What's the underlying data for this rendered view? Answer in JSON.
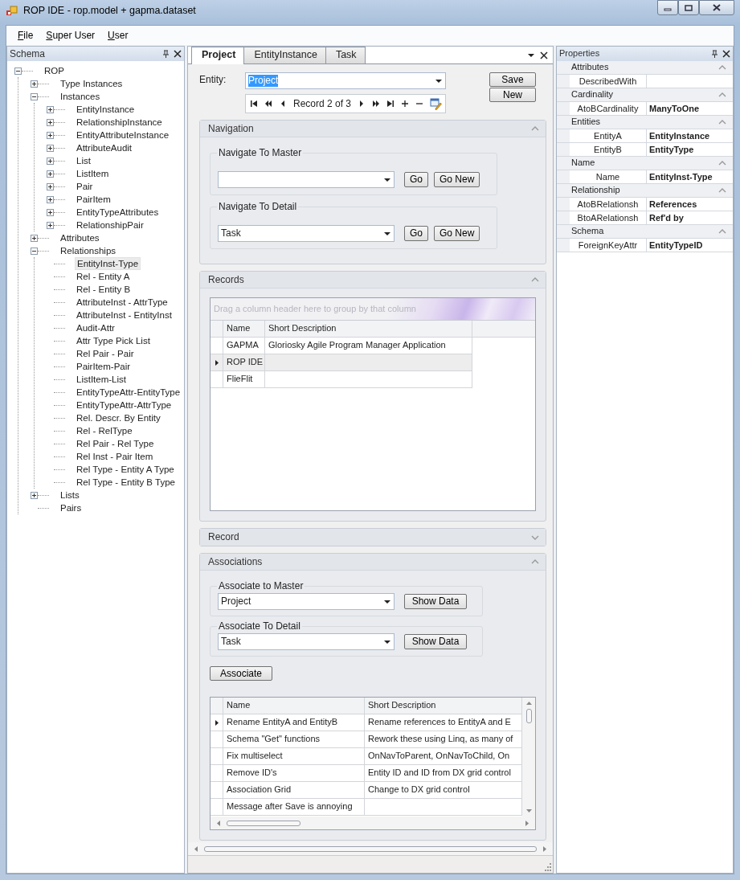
{
  "window": {
    "title": "ROP IDE - rop.model + gapma.dataset"
  },
  "menu": [
    {
      "label": "File"
    },
    {
      "label": "Super User"
    },
    {
      "label": "User"
    }
  ],
  "schema_panel": {
    "title": "Schema",
    "tree": [
      {
        "label": "ROP",
        "expanded": true,
        "selected": false,
        "children": [
          {
            "label": "Type Instances",
            "expanded": false,
            "selected": false
          },
          {
            "label": "Instances",
            "expanded": true,
            "selected": false,
            "children": [
              {
                "label": "EntityInstance",
                "expanded": false,
                "selected": false
              },
              {
                "label": "RelationshipInstance",
                "expanded": false,
                "selected": false
              },
              {
                "label": "EntityAttributeInstance",
                "expanded": false,
                "selected": false
              },
              {
                "label": "AttributeAudit",
                "expanded": false,
                "selected": false
              },
              {
                "label": "List",
                "expanded": false,
                "selected": false
              },
              {
                "label": "ListItem",
                "expanded": false,
                "selected": false
              },
              {
                "label": "Pair",
                "expanded": false,
                "selected": false
              },
              {
                "label": "PairItem",
                "expanded": false,
                "selected": false
              },
              {
                "label": "EntityTypeAttributes",
                "expanded": false,
                "selected": false
              },
              {
                "label": "RelationshipPair",
                "expanded": false,
                "selected": false
              }
            ]
          },
          {
            "label": "Attributes",
            "expanded": false,
            "selected": false
          },
          {
            "label": "Relationships",
            "expanded": true,
            "selected": false,
            "children": [
              {
                "label": "EntityInst-Type",
                "selected": true
              },
              {
                "label": "Rel - Entity A",
                "selected": false
              },
              {
                "label": "Rel - Entity B",
                "selected": false
              },
              {
                "label": "AttributeInst - AttrType",
                "selected": false
              },
              {
                "label": "AttributeInst - EntityInst",
                "selected": false
              },
              {
                "label": "Audit-Attr",
                "selected": false
              },
              {
                "label": "Attr Type Pick List",
                "selected": false
              },
              {
                "label": "Rel Pair - Pair",
                "selected": false
              },
              {
                "label": "PairItem-Pair",
                "selected": false
              },
              {
                "label": "ListItem-List",
                "selected": false
              },
              {
                "label": "EntityTypeAttr-EntityType",
                "selected": false
              },
              {
                "label": "EntityTypeAttr-AttrType",
                "selected": false
              },
              {
                "label": "Rel. Descr. By Entity",
                "selected": false
              },
              {
                "label": "Rel - RelType",
                "selected": false
              },
              {
                "label": "Rel Pair - Rel Type",
                "selected": false
              },
              {
                "label": "Rel Inst - Pair Item",
                "selected": false
              },
              {
                "label": "Rel Type - Entity A Type",
                "selected": false
              },
              {
                "label": "Rel Type - Entity B Type",
                "selected": false
              }
            ]
          },
          {
            "label": "Lists",
            "expanded": false,
            "selected": false
          },
          {
            "label": "Pairs",
            "selected": false
          }
        ]
      }
    ]
  },
  "tabs": [
    {
      "label": "Project",
      "selected": true
    },
    {
      "label": "EntityInstance",
      "selected": false
    },
    {
      "label": "Task",
      "selected": false
    }
  ],
  "entity": {
    "label": "Entity:",
    "value": "Project",
    "text_selected": true
  },
  "navigator": {
    "text": "Record 2 of 3"
  },
  "actions": [
    {
      "label": "Save"
    },
    {
      "label": "New"
    }
  ],
  "sections": [
    {
      "kind": "navigate",
      "title": "Navigation",
      "expanded": true,
      "groups": [
        {
          "title": "Navigate To Master",
          "buttons": [
            "Go",
            "Go New"
          ]
        },
        {
          "title": "Navigate To Detail",
          "value": "Task",
          "buttons": [
            "Go",
            "Go New"
          ]
        }
      ]
    },
    {
      "kind": "grid",
      "title": "Records",
      "expanded": true,
      "group_hint": "Drag a column header here to group by that column",
      "columns": [
        "Name",
        "Short Description"
      ],
      "rows": [
        {
          "cells": [
            "GAPMA",
            "Gloriosky Agile Program Manager Application"
          ],
          "selected": false
        },
        {
          "cells": [
            "ROP IDE",
            ""
          ],
          "selected": true
        },
        {
          "cells": [
            "FlieFlit",
            ""
          ],
          "selected": false
        }
      ]
    },
    {
      "title": "Record",
      "expanded": false
    },
    {
      "kind": "associate",
      "title": "Associations",
      "expanded": true,
      "groups": [
        {
          "title": "Associate to Master",
          "value": "Project",
          "button": "Show Data"
        },
        {
          "title": "Associate To Detail",
          "value": "Task",
          "button": "Show Data"
        }
      ],
      "action": "Associate",
      "columns": [
        "Name",
        "Short Description"
      ],
      "rows": [
        {
          "cells": [
            "Rename EntityA and EntityB",
            "Rename references to EntityA and E"
          ],
          "selected": true
        },
        {
          "cells": [
            "Schema \"Get\" functions",
            "Rework these using Linq, as many of"
          ],
          "selected": false
        },
        {
          "cells": [
            "Fix multiselect",
            "OnNavToParent, OnNavToChild, On"
          ],
          "selected": false
        },
        {
          "cells": [
            "Remove ID's",
            "Entity ID and ID from DX grid control"
          ],
          "selected": false
        },
        {
          "cells": [
            "Association Grid",
            "Change to DX grid control"
          ],
          "selected": false
        },
        {
          "cells": [
            "Message after Save is annoying",
            ""
          ],
          "selected": false
        }
      ]
    }
  ],
  "properties_panel": {
    "title": "Properties",
    "categories": [
      {
        "name": "Attributes",
        "expanded": true,
        "rows": [
          {
            "name": "DescribedWith"
          }
        ]
      },
      {
        "name": "Cardinality",
        "expanded": true,
        "rows": [
          {
            "name": "AtoBCardinality",
            "value": "ManyToOne"
          }
        ]
      },
      {
        "name": "Entities",
        "expanded": true,
        "rows": [
          {
            "name": "EntityA",
            "value": "EntityInstance"
          },
          {
            "name": "EntityB",
            "value": "EntityType"
          }
        ]
      },
      {
        "name": "Name",
        "expanded": true,
        "rows": [
          {
            "name": "Name",
            "value": "EntityInst-Type"
          }
        ]
      },
      {
        "name": "Relationship",
        "expanded": true,
        "rows": [
          {
            "name": "AtoBRelationsh",
            "value": "References"
          },
          {
            "name": "BtoARelationsh",
            "value": "Ref'd by"
          }
        ]
      },
      {
        "name": "Schema",
        "expanded": true,
        "rows": [
          {
            "name": "ForeignKeyAttr",
            "value": "EntityTypeID"
          }
        ]
      }
    ]
  }
}
